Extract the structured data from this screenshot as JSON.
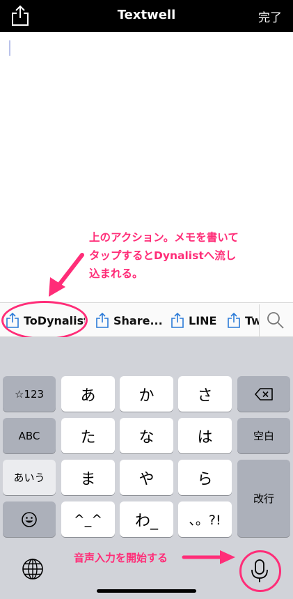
{
  "nav": {
    "title": "Textwell",
    "done_label": "完了"
  },
  "annotations": {
    "top_lines": [
      "上のアクション。メモを書いて",
      "タップするとDynalistへ流し",
      "込まれる。"
    ],
    "mic": "音声入力を開始する",
    "color": "#ff2d78"
  },
  "actions": [
    {
      "label": "ToDynalist",
      "icon": "share-icon"
    },
    {
      "label": "Share...",
      "icon": "share-icon"
    },
    {
      "label": "LINE",
      "icon": "share-icon"
    },
    {
      "label": "Tw",
      "icon": "share-icon"
    }
  ],
  "keyboard": {
    "left_col": [
      "☆123",
      "ABC",
      "あいう",
      "emoji-icon"
    ],
    "rows": [
      [
        "あ",
        "か",
        "さ"
      ],
      [
        "た",
        "な",
        "は"
      ],
      [
        "ま",
        "や",
        "ら"
      ],
      [
        "^_^",
        "わ_",
        "、。?!"
      ]
    ],
    "right_col": {
      "delete_icon": "delete-icon",
      "space": "空白",
      "return": "改行"
    }
  }
}
